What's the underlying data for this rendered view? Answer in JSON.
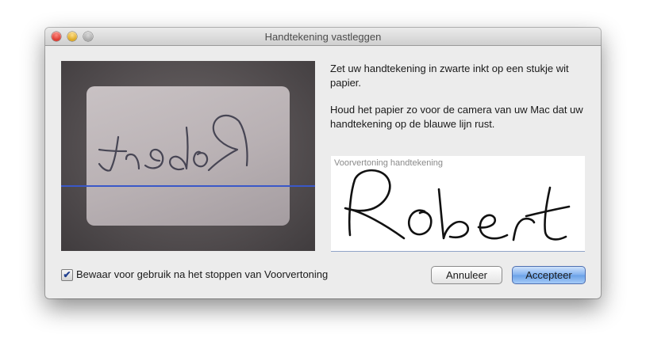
{
  "window": {
    "title": "Handtekening vastleggen"
  },
  "instructions": {
    "line1": "Zet uw handtekening in zwarte inkt op een stukje wit papier.",
    "line2": "Houd het papier zo voor de camera van uw Mac dat uw handtekening op de blauwe lijn rust."
  },
  "camera": {
    "line_color": "#3a58c8"
  },
  "preview": {
    "label": "Voorvertoning handtekening"
  },
  "options": {
    "keep_label": "Bewaar voor gebruik na het stoppen van Voorvertoning",
    "keep_checked": true
  },
  "buttons": {
    "cancel": "Annuleer",
    "accept": "Accepteer"
  },
  "icons": [
    "close-icon",
    "minimize-icon",
    "zoom-icon",
    "checkmark-icon"
  ],
  "colors": {
    "accent": "#6aa0e6",
    "window_bg": "#ececec"
  }
}
